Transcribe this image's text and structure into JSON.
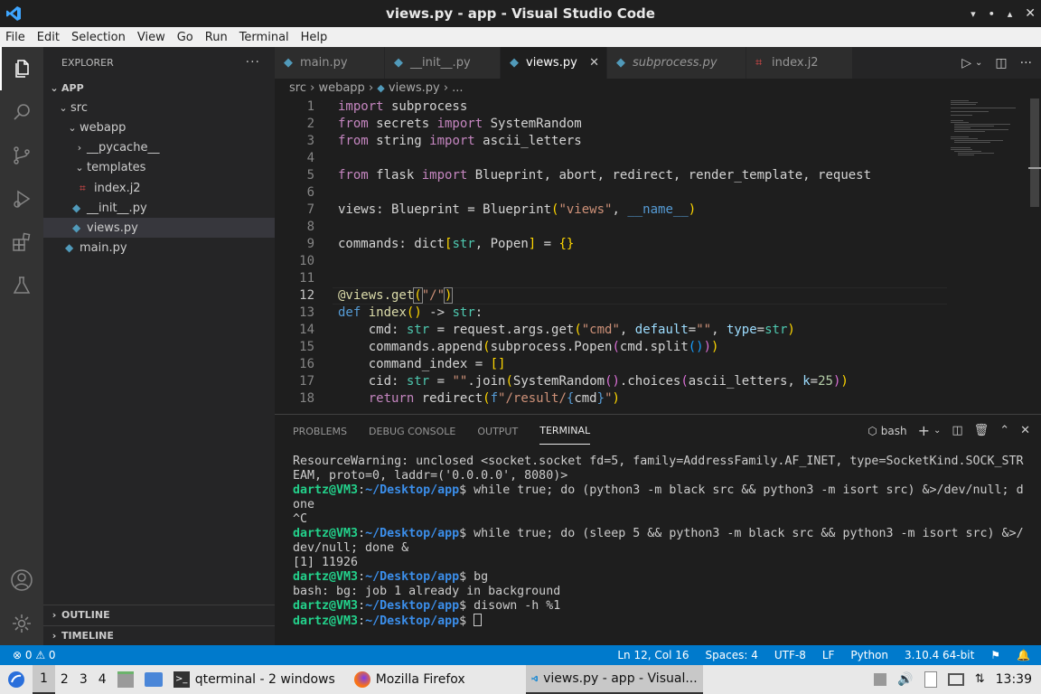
{
  "window": {
    "title": "views.py - app - Visual Studio Code"
  },
  "menu": [
    "File",
    "Edit",
    "Selection",
    "View",
    "Go",
    "Run",
    "Terminal",
    "Help"
  ],
  "activity": [
    "explorer-icon",
    "search-icon",
    "source-control-icon",
    "run-debug-icon",
    "extensions-icon",
    "testing-icon",
    "account-icon",
    "settings-gear-icon"
  ],
  "explorer": {
    "title": "EXPLORER",
    "root": "APP",
    "items": [
      {
        "label": "src",
        "indent": 0,
        "chev": "v",
        "icon": ""
      },
      {
        "label": "webapp",
        "indent": 1,
        "chev": "v",
        "icon": ""
      },
      {
        "label": "__pycache__",
        "indent": 2,
        "chev": ">",
        "icon": ""
      },
      {
        "label": "templates",
        "indent": 2,
        "chev": "v",
        "icon": ""
      },
      {
        "label": "index.j2",
        "indent": 3,
        "chev": "",
        "icon": "jinja"
      },
      {
        "label": "__init__.py",
        "indent": 2,
        "chev": "",
        "icon": "py"
      },
      {
        "label": "views.py",
        "indent": 2,
        "chev": "",
        "icon": "py",
        "selected": true
      },
      {
        "label": "main.py",
        "indent": 1,
        "chev": "",
        "icon": "py"
      }
    ],
    "outline": "OUTLINE",
    "timeline": "TIMELINE"
  },
  "tabs": [
    {
      "label": "main.py",
      "icon": "py"
    },
    {
      "label": "__init__.py",
      "icon": "py"
    },
    {
      "label": "views.py",
      "icon": "py",
      "active": true
    },
    {
      "label": "subprocess.py",
      "icon": "py",
      "italic": true
    },
    {
      "label": "index.j2",
      "icon": "jinja"
    }
  ],
  "breadcrumb": {
    "p1": "src",
    "p2": "webapp",
    "p3": "views.py",
    "p4": "..."
  },
  "editor": {
    "current_line": 12
  },
  "panel": {
    "tabs": [
      "PROBLEMS",
      "DEBUG CONSOLE",
      "OUTPUT",
      "TERMINAL"
    ],
    "active": "TERMINAL",
    "shell": "bash"
  },
  "terminal": {
    "l1": "ResourceWarning: unclosed <socket.socket fd=5, family=AddressFamily.AF_INET, type=SocketKind.SOCK_STR",
    "l2": "EAM, proto=0, laddr=('0.0.0.0', 8080)>",
    "user": "dartz@VM3",
    "path": "~/Desktop/app",
    "c1": "$ while true; do (python3 -m black src && python3 -m isort src) &>/dev/null; d",
    "c1b": "one",
    "l5": "^C",
    "c2": "$ while true; do (sleep 5 && python3 -m black src && python3 -m isort src) &>/",
    "c2b": "dev/null; done &",
    "l8": "[1] 11926",
    "c3": "$ bg",
    "l10": "bash: bg: job 1 already in background",
    "c4": "$ disown -h %1",
    "c5": "$ "
  },
  "status": {
    "problems": "⊗ 0 ⚠ 0",
    "position": "Ln 12, Col 16",
    "spaces": "Spaces: 4",
    "encoding": "UTF-8",
    "eol": "LF",
    "language": "Python",
    "interpreter": "3.10.4 64-bit"
  },
  "taskbar": {
    "workspaces": [
      "1",
      "2",
      "3",
      "4"
    ],
    "apps": [
      "qterminal - 2 windows",
      "Mozilla Firefox",
      "views.py - app - Visual..."
    ],
    "clock": "13:39"
  },
  "colors": {
    "accent": "#007acc",
    "activity": "#333333",
    "sidebar": "#252526",
    "editor": "#1e1e1e"
  }
}
